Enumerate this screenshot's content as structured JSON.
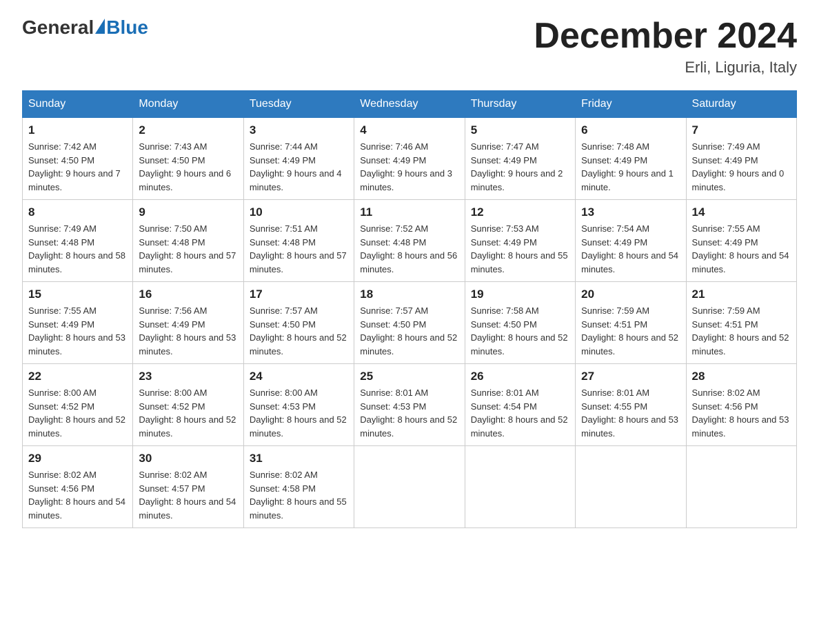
{
  "header": {
    "logo_general": "General",
    "logo_blue": "Blue",
    "month_title": "December 2024",
    "location": "Erli, Liguria, Italy"
  },
  "days_of_week": [
    "Sunday",
    "Monday",
    "Tuesday",
    "Wednesday",
    "Thursday",
    "Friday",
    "Saturday"
  ],
  "weeks": [
    [
      {
        "day": "1",
        "sunrise": "7:42 AM",
        "sunset": "4:50 PM",
        "daylight": "9 hours and 7 minutes."
      },
      {
        "day": "2",
        "sunrise": "7:43 AM",
        "sunset": "4:50 PM",
        "daylight": "9 hours and 6 minutes."
      },
      {
        "day": "3",
        "sunrise": "7:44 AM",
        "sunset": "4:49 PM",
        "daylight": "9 hours and 4 minutes."
      },
      {
        "day": "4",
        "sunrise": "7:46 AM",
        "sunset": "4:49 PM",
        "daylight": "9 hours and 3 minutes."
      },
      {
        "day": "5",
        "sunrise": "7:47 AM",
        "sunset": "4:49 PM",
        "daylight": "9 hours and 2 minutes."
      },
      {
        "day": "6",
        "sunrise": "7:48 AM",
        "sunset": "4:49 PM",
        "daylight": "9 hours and 1 minute."
      },
      {
        "day": "7",
        "sunrise": "7:49 AM",
        "sunset": "4:49 PM",
        "daylight": "9 hours and 0 minutes."
      }
    ],
    [
      {
        "day": "8",
        "sunrise": "7:49 AM",
        "sunset": "4:48 PM",
        "daylight": "8 hours and 58 minutes."
      },
      {
        "day": "9",
        "sunrise": "7:50 AM",
        "sunset": "4:48 PM",
        "daylight": "8 hours and 57 minutes."
      },
      {
        "day": "10",
        "sunrise": "7:51 AM",
        "sunset": "4:48 PM",
        "daylight": "8 hours and 57 minutes."
      },
      {
        "day": "11",
        "sunrise": "7:52 AM",
        "sunset": "4:48 PM",
        "daylight": "8 hours and 56 minutes."
      },
      {
        "day": "12",
        "sunrise": "7:53 AM",
        "sunset": "4:49 PM",
        "daylight": "8 hours and 55 minutes."
      },
      {
        "day": "13",
        "sunrise": "7:54 AM",
        "sunset": "4:49 PM",
        "daylight": "8 hours and 54 minutes."
      },
      {
        "day": "14",
        "sunrise": "7:55 AM",
        "sunset": "4:49 PM",
        "daylight": "8 hours and 54 minutes."
      }
    ],
    [
      {
        "day": "15",
        "sunrise": "7:55 AM",
        "sunset": "4:49 PM",
        "daylight": "8 hours and 53 minutes."
      },
      {
        "day": "16",
        "sunrise": "7:56 AM",
        "sunset": "4:49 PM",
        "daylight": "8 hours and 53 minutes."
      },
      {
        "day": "17",
        "sunrise": "7:57 AM",
        "sunset": "4:50 PM",
        "daylight": "8 hours and 52 minutes."
      },
      {
        "day": "18",
        "sunrise": "7:57 AM",
        "sunset": "4:50 PM",
        "daylight": "8 hours and 52 minutes."
      },
      {
        "day": "19",
        "sunrise": "7:58 AM",
        "sunset": "4:50 PM",
        "daylight": "8 hours and 52 minutes."
      },
      {
        "day": "20",
        "sunrise": "7:59 AM",
        "sunset": "4:51 PM",
        "daylight": "8 hours and 52 minutes."
      },
      {
        "day": "21",
        "sunrise": "7:59 AM",
        "sunset": "4:51 PM",
        "daylight": "8 hours and 52 minutes."
      }
    ],
    [
      {
        "day": "22",
        "sunrise": "8:00 AM",
        "sunset": "4:52 PM",
        "daylight": "8 hours and 52 minutes."
      },
      {
        "day": "23",
        "sunrise": "8:00 AM",
        "sunset": "4:52 PM",
        "daylight": "8 hours and 52 minutes."
      },
      {
        "day": "24",
        "sunrise": "8:00 AM",
        "sunset": "4:53 PM",
        "daylight": "8 hours and 52 minutes."
      },
      {
        "day": "25",
        "sunrise": "8:01 AM",
        "sunset": "4:53 PM",
        "daylight": "8 hours and 52 minutes."
      },
      {
        "day": "26",
        "sunrise": "8:01 AM",
        "sunset": "4:54 PM",
        "daylight": "8 hours and 52 minutes."
      },
      {
        "day": "27",
        "sunrise": "8:01 AM",
        "sunset": "4:55 PM",
        "daylight": "8 hours and 53 minutes."
      },
      {
        "day": "28",
        "sunrise": "8:02 AM",
        "sunset": "4:56 PM",
        "daylight": "8 hours and 53 minutes."
      }
    ],
    [
      {
        "day": "29",
        "sunrise": "8:02 AM",
        "sunset": "4:56 PM",
        "daylight": "8 hours and 54 minutes."
      },
      {
        "day": "30",
        "sunrise": "8:02 AM",
        "sunset": "4:57 PM",
        "daylight": "8 hours and 54 minutes."
      },
      {
        "day": "31",
        "sunrise": "8:02 AM",
        "sunset": "4:58 PM",
        "daylight": "8 hours and 55 minutes."
      },
      null,
      null,
      null,
      null
    ]
  ]
}
